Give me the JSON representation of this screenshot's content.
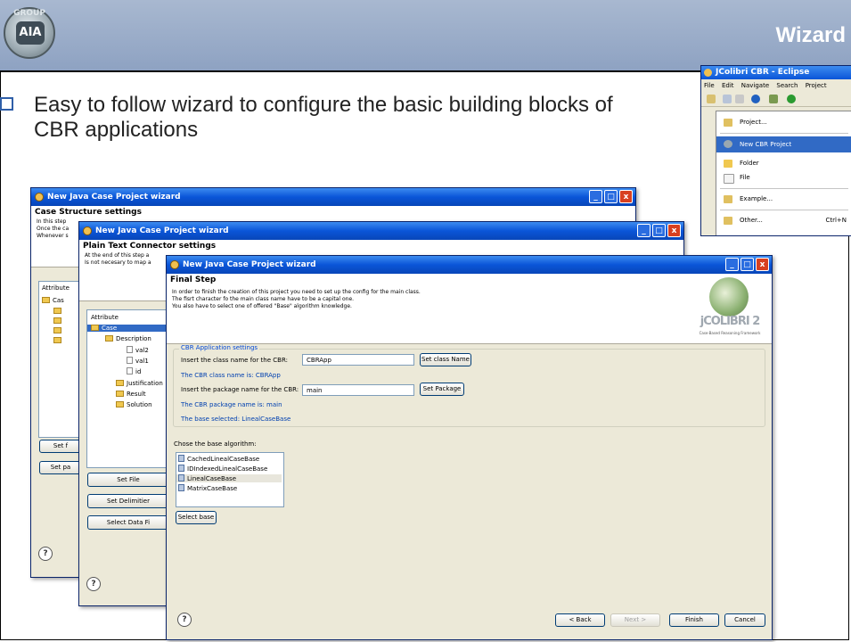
{
  "slide": {
    "title": "Wizard",
    "logo_text": "AIA",
    "logo_ring": "GROUP",
    "bullet": "Easy to follow wizard to configure the basic building blocks of CBR applications"
  },
  "colors": {
    "header": "#8ea2c2",
    "xp_titlebar": "#0a55d8",
    "bullet_box": "#2f5fa8",
    "selection": "#316ac5"
  },
  "eclipse": {
    "title": "JColibri CBR - Eclipse",
    "menubar": [
      "File",
      "Edit",
      "Navigate",
      "Search",
      "Project"
    ],
    "menu": {
      "items": [
        {
          "label": "Project...",
          "icon": "project-icon"
        },
        {
          "label": "New CBR Project",
          "icon": "cbr-project-icon",
          "selected": true
        },
        {
          "label": "Folder",
          "icon": "folder-icon"
        },
        {
          "label": "File",
          "icon": "file-icon"
        },
        {
          "label": "Example...",
          "icon": "example-icon"
        },
        {
          "label": "Other...",
          "icon": "other-icon",
          "shortcut": "Ctrl+N"
        }
      ]
    }
  },
  "win1": {
    "title": "New Java Case Project wizard",
    "heading": "Case Structure settings",
    "desc": [
      "In this step",
      "Once the ca",
      "Whenever s"
    ],
    "attr_header": "Attribute",
    "tree_root": "Cas",
    "btn_set": "Set f",
    "btn_set_pa": "Set pa",
    "help": "?"
  },
  "win2": {
    "title": "New Java Case Project wizard",
    "heading": "Plain Text Connector settings",
    "desc": [
      "At the end of this step a",
      "Is not necesary to map a"
    ],
    "attr_header": "Attribute",
    "tree": {
      "case": "Case",
      "description": "Description",
      "val2": "val2",
      "val1": "val1",
      "id": "id",
      "justification": "Justification",
      "result": "Result",
      "solution": "Solution"
    },
    "btn_set_file": "Set File",
    "btn_set_delim": "Set Delimitier",
    "btn_select_data": "Select Data Fi",
    "help": "?"
  },
  "win3": {
    "title": "New Java Case Project wizard",
    "heading": "Final Step",
    "desc": [
      "In order to finish the creation of this project you need to set up the config for the main class.",
      "The fisrt character fo the main class name have to be a capital one.",
      "You also have to select one of offered \"Base\" algorithm knowledge."
    ],
    "brand": "jCOLIBRI 2",
    "brand_sub": "Case-Based Reasoning Framework",
    "group_label": "CBR Application settings",
    "class_label": "Insert the class name for the CBR:",
    "class_value": "CBRApp",
    "btn_set_class": "Set class Name",
    "class_info": "The CBR class name is: CBRApp",
    "package_label": "Insert the package name for the CBR:",
    "package_value": "main",
    "btn_set_package": "Set Package",
    "package_info": "The CBR package name is: main",
    "base_info": "The base selected: LinealCaseBase",
    "chose_label": "Chose the base algorithm:",
    "algorithms": [
      "CachedLinealCaseBase",
      "IDIndexedLinealCaseBase",
      "LinealCaseBase",
      "MatrixCaseBase"
    ],
    "btn_select_base": "Select base",
    "btn_back": "< Back",
    "btn_next": "Next >",
    "btn_finish": "Finish",
    "btn_cancel": "Cancel",
    "help": "?"
  }
}
